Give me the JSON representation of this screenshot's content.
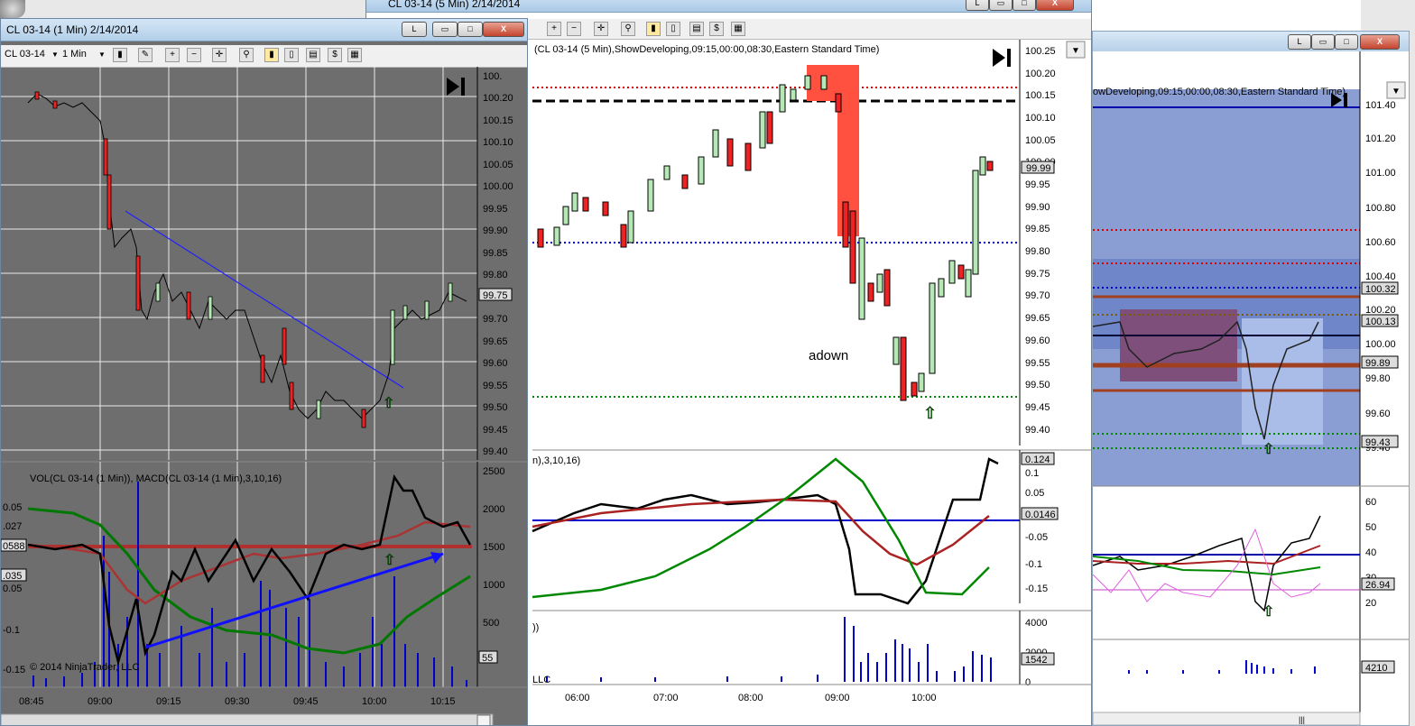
{
  "left_window": {
    "title": "CL 03-14 (1 Min)  2/14/2014",
    "instrument": "CL 03-14",
    "interval": "1 Min",
    "y_ticks": [
      "100.",
      "100.20",
      "100.15",
      "100.10",
      "100.05",
      "100.00",
      "99.95",
      "99.90",
      "99.85",
      "99.80",
      "99.75",
      "99.70",
      "99.65",
      "99.60",
      "99.55",
      "99.50",
      "99.45",
      "99.40"
    ],
    "last_price": "99.75",
    "indicator_label": "VOL(CL 03-14 (1 Min)), MACD(CL 03-14 (1 Min),3,10,16)",
    "ind_left_labels": [
      "0.05",
      ".027",
      "0588",
      ".035",
      "0.05",
      "-0.1",
      "-0.15"
    ],
    "vol_ticks": [
      "2500",
      "2000",
      "1500",
      "1000",
      "500",
      "55"
    ],
    "time_ticks": [
      "08:45",
      "09:00",
      "09:15",
      "09:30",
      "09:45",
      "10:00",
      "10:15"
    ],
    "copyright": "© 2014 NinjaTrader, LLC"
  },
  "middle_window": {
    "title": "CL 03-14 (5 Min)  2/14/2014",
    "vp_label": "(CL 03-14 (5 Min),ShowDeveloping,09:15,00:00,08:30,Eastern Standard Time)",
    "y_ticks": [
      "100.25",
      "100.20",
      "100.15",
      "100.10",
      "100.05",
      "100.00",
      "99.95",
      "99.90",
      "99.85",
      "99.80",
      "99.75",
      "99.70",
      "99.65",
      "99.60",
      "99.55",
      "99.50",
      "99.45",
      "99.40"
    ],
    "last_price": "99.99",
    "annotation": "adown",
    "macd_label": "n),3,10,16)",
    "macd_ticks": [
      "0.124",
      "0.1",
      "0.05",
      "0.0146",
      "-0.05",
      "-0.1",
      "-0.15"
    ],
    "vol_label": "))",
    "vol_ticks": [
      "4000",
      "2000",
      "1542",
      "0"
    ],
    "vol_footer": "LLC",
    "time_ticks": [
      "06:00",
      "07:00",
      "08:00",
      "09:00",
      "10:00"
    ]
  },
  "right_window": {
    "vp_label": "owDeveloping,09:15,00:00,08:30,Eastern Standard Time)",
    "y_ticks": [
      "101.40",
      "101.20",
      "101.00",
      "100.80",
      "100.60",
      "100.40",
      "100.20",
      "100.00",
      "99.80",
      "99.60",
      "99.40"
    ],
    "price_tags": [
      "100.32",
      "100.13",
      "99.89",
      "99.43"
    ],
    "ind_ticks": [
      "60",
      "50",
      "40",
      "30",
      "20"
    ],
    "ind_tag": "26.94",
    "vol_tag": "4210"
  },
  "buttons": {
    "link": "L",
    "restore": "▭",
    "max": "□",
    "close": "X"
  },
  "chart_data": [
    {
      "type": "line",
      "title": "CL 03-14 (1 Min)  2/14/2014",
      "x": [
        "08:45",
        "09:00",
        "09:15",
        "09:30",
        "09:45",
        "10:00",
        "10:15"
      ],
      "series": [
        {
          "values": [
            100.17,
            100.12,
            99.78,
            99.72,
            99.5,
            99.55,
            99.75
          ]
        }
      ]
    },
    {
      "type": "line",
      "title": "CL 03-14 (5 Min)  2/14/2014",
      "x": [
        "06:00",
        "07:00",
        "08:00",
        "09:00",
        "10:00"
      ],
      "series": [
        {
          "values": [
            99.85,
            100.0,
            100.05,
            99.7,
            99.99
          ]
        }
      ]
    }
  ]
}
